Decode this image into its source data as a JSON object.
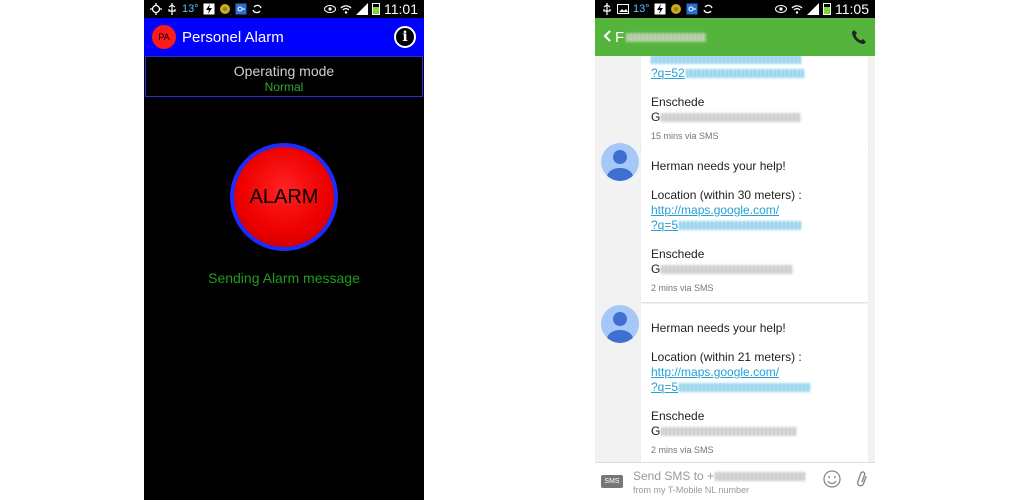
{
  "status_left": {
    "temp": "13°",
    "time": "11:01"
  },
  "status_right": {
    "temp": "13°",
    "time": "11:05"
  },
  "alarm_app": {
    "logo_text": "PA",
    "title": "Personel Alarm",
    "mode_label": "Operating mode",
    "mode_value": "Normal",
    "alarm_button": "ALARM",
    "status_text": "Sending Alarm message"
  },
  "sms_app": {
    "contact_initial": "F",
    "messages": [
      {
        "link_tail": "?q=52",
        "city": "Enschede",
        "address_prefix": "G",
        "meta": "15 mins via SMS"
      },
      {
        "headline": "Herman needs your help!",
        "location": "Location (within 30 meters) :",
        "link": "http://maps.google.com/",
        "link_tail": "?q=5",
        "city": "Enschede",
        "address_prefix": "G",
        "meta": "2 mins via SMS"
      },
      {
        "headline": "Herman needs your help!",
        "location": "Location (within 21 meters) :",
        "link": "http://maps.google.com/",
        "link_tail": "?q=5",
        "city": "Enschede",
        "address_prefix": "G",
        "meta": "2 mins via SMS"
      }
    ],
    "compose": {
      "sms_badge": "SMS",
      "placeholder": "Send SMS to +",
      "subtext": "from my T-Mobile NL number"
    }
  },
  "colors": {
    "alarm_bar": "#0000ff",
    "alarm_button": "#ee0000",
    "status_green": "#1f9c1f",
    "sms_bar": "#55b43c",
    "link": "#26a0d6"
  },
  "icons": [
    "location-icon",
    "usb-icon",
    "gallery-icon",
    "wifi-icon",
    "signal-icon",
    "battery-icon",
    "info-icon",
    "back-icon",
    "phone-icon",
    "smiley-icon",
    "paperclip-icon"
  ]
}
